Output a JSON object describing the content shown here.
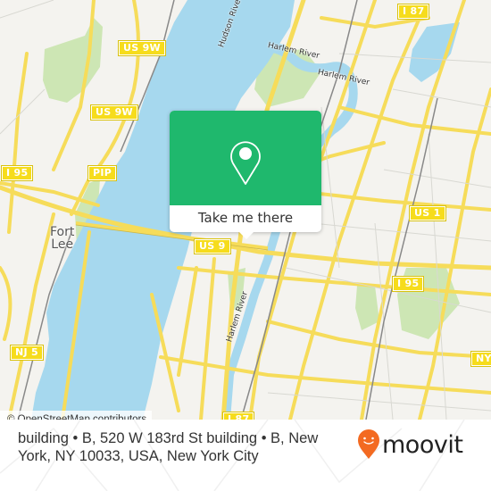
{
  "map": {
    "place_labels": [
      {
        "name": "fort-lee",
        "text": "Fort\nLee"
      }
    ],
    "water_labels": [
      {
        "name": "hudson-river",
        "text": "Hudson River"
      },
      {
        "name": "harlem-river-north-1",
        "text": "Harlem River"
      },
      {
        "name": "harlem-river-north-2",
        "text": "Harlem River"
      },
      {
        "name": "harlem-river-south",
        "text": "Harlem River"
      }
    ],
    "road_shields": [
      {
        "name": "us-9w-north",
        "text": "US 9W"
      },
      {
        "name": "us-9w-south",
        "text": "US 9W"
      },
      {
        "name": "i-95-west",
        "text": "I 95"
      },
      {
        "name": "pip",
        "text": "PIP"
      },
      {
        "name": "i-87-north",
        "text": "I 87"
      },
      {
        "name": "us-9",
        "text": "US 9"
      },
      {
        "name": "us-1",
        "text": "US 1"
      },
      {
        "name": "i-95-east",
        "text": "I 95"
      },
      {
        "name": "nj-5",
        "text": "NJ 5"
      },
      {
        "name": "ny-partial",
        "text": "NY"
      },
      {
        "name": "i-87-south",
        "text": "I 87"
      }
    ],
    "colors": {
      "water": "#a6d8ee",
      "land": "#f4f3ef",
      "park": "#cde6b4",
      "road": "#f6dc5a",
      "rail": "#777777",
      "shield": "#f6dc1c"
    },
    "attribution": "© OpenStreetMap contributors"
  },
  "popup": {
    "icon": "map-pin-icon",
    "button_label": "Take me there",
    "color": "#1fb86d"
  },
  "footer": {
    "address": "building • B, 520 W 183rd St building • B, New York, NY 10033, USA, New York City",
    "logo_text": "moovit",
    "logo_color": "#f36a21"
  }
}
